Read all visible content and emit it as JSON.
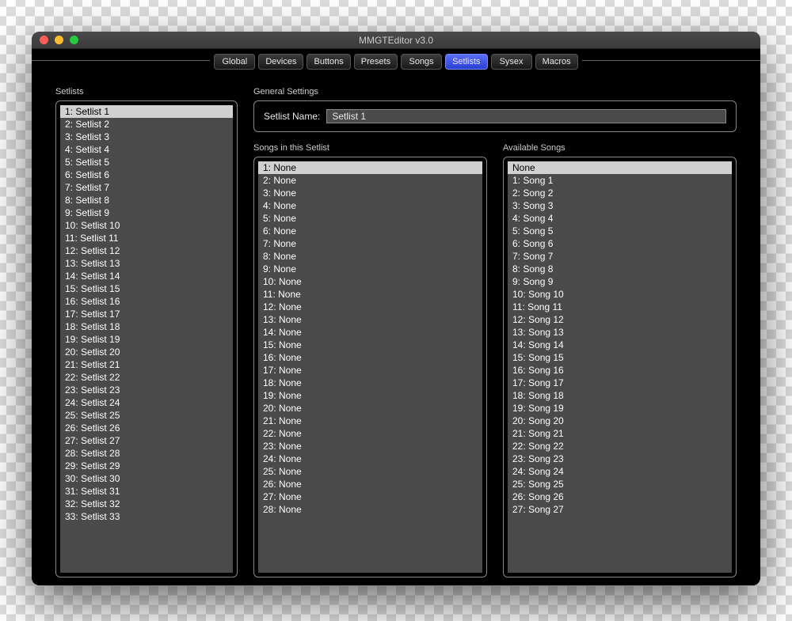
{
  "window_title": "MMGTEditor v3.0",
  "tabs": [
    {
      "label": "Global",
      "active": false
    },
    {
      "label": "Devices",
      "active": false
    },
    {
      "label": "Buttons",
      "active": false
    },
    {
      "label": "Presets",
      "active": false
    },
    {
      "label": "Songs",
      "active": false
    },
    {
      "label": "Setlists",
      "active": true
    },
    {
      "label": "Sysex",
      "active": false
    },
    {
      "label": "Macros",
      "active": false
    }
  ],
  "sections": {
    "setlists_label": "Setlists",
    "general_label": "General Settings",
    "songs_in_label": "Songs in this Setlist",
    "available_label": "Available Songs",
    "name_field_label": "Setlist Name:"
  },
  "setlist_name_value": "Setlist 1",
  "setlists": [
    "1: Setlist 1",
    "2: Setlist 2",
    "3: Setlist 3",
    "4: Setlist 4",
    "5: Setlist 5",
    "6: Setlist 6",
    "7: Setlist 7",
    "8: Setlist 8",
    "9: Setlist 9",
    "10: Setlist 10",
    "11: Setlist 11",
    "12: Setlist 12",
    "13: Setlist 13",
    "14: Setlist 14",
    "15: Setlist 15",
    "16: Setlist 16",
    "17: Setlist 17",
    "18: Setlist 18",
    "19: Setlist 19",
    "20: Setlist 20",
    "21: Setlist 21",
    "22: Setlist 22",
    "23: Setlist 23",
    "24: Setlist 24",
    "25: Setlist 25",
    "26: Setlist 26",
    "27: Setlist 27",
    "28: Setlist 28",
    "29: Setlist 29",
    "30: Setlist 30",
    "31: Setlist 31",
    "32: Setlist 32",
    "33: Setlist 33"
  ],
  "setlists_selected": 0,
  "songs_in_setlist": [
    "1: None",
    "2: None",
    "3: None",
    "4: None",
    "5: None",
    "6: None",
    "7: None",
    "8: None",
    "9: None",
    "10: None",
    "11: None",
    "12: None",
    "13: None",
    "14: None",
    "15: None",
    "16: None",
    "17: None",
    "18: None",
    "19: None",
    "20: None",
    "21: None",
    "22: None",
    "23: None",
    "24: None",
    "25: None",
    "26: None",
    "27: None",
    "28: None"
  ],
  "songs_in_selected": 0,
  "available_songs": [
    "None",
    "1: Song 1",
    "2: Song 2",
    "3: Song 3",
    "4: Song 4",
    "5: Song 5",
    "6: Song 6",
    "7: Song 7",
    "8: Song 8",
    "9: Song 9",
    "10: Song 10",
    "11: Song 11",
    "12: Song 12",
    "13: Song 13",
    "14: Song 14",
    "15: Song 15",
    "16: Song 16",
    "17: Song 17",
    "18: Song 18",
    "19: Song 19",
    "20: Song 20",
    "21: Song 21",
    "22: Song 22",
    "23: Song 23",
    "24: Song 24",
    "25: Song 25",
    "26: Song 26",
    "27: Song 27"
  ],
  "available_selected": 0
}
